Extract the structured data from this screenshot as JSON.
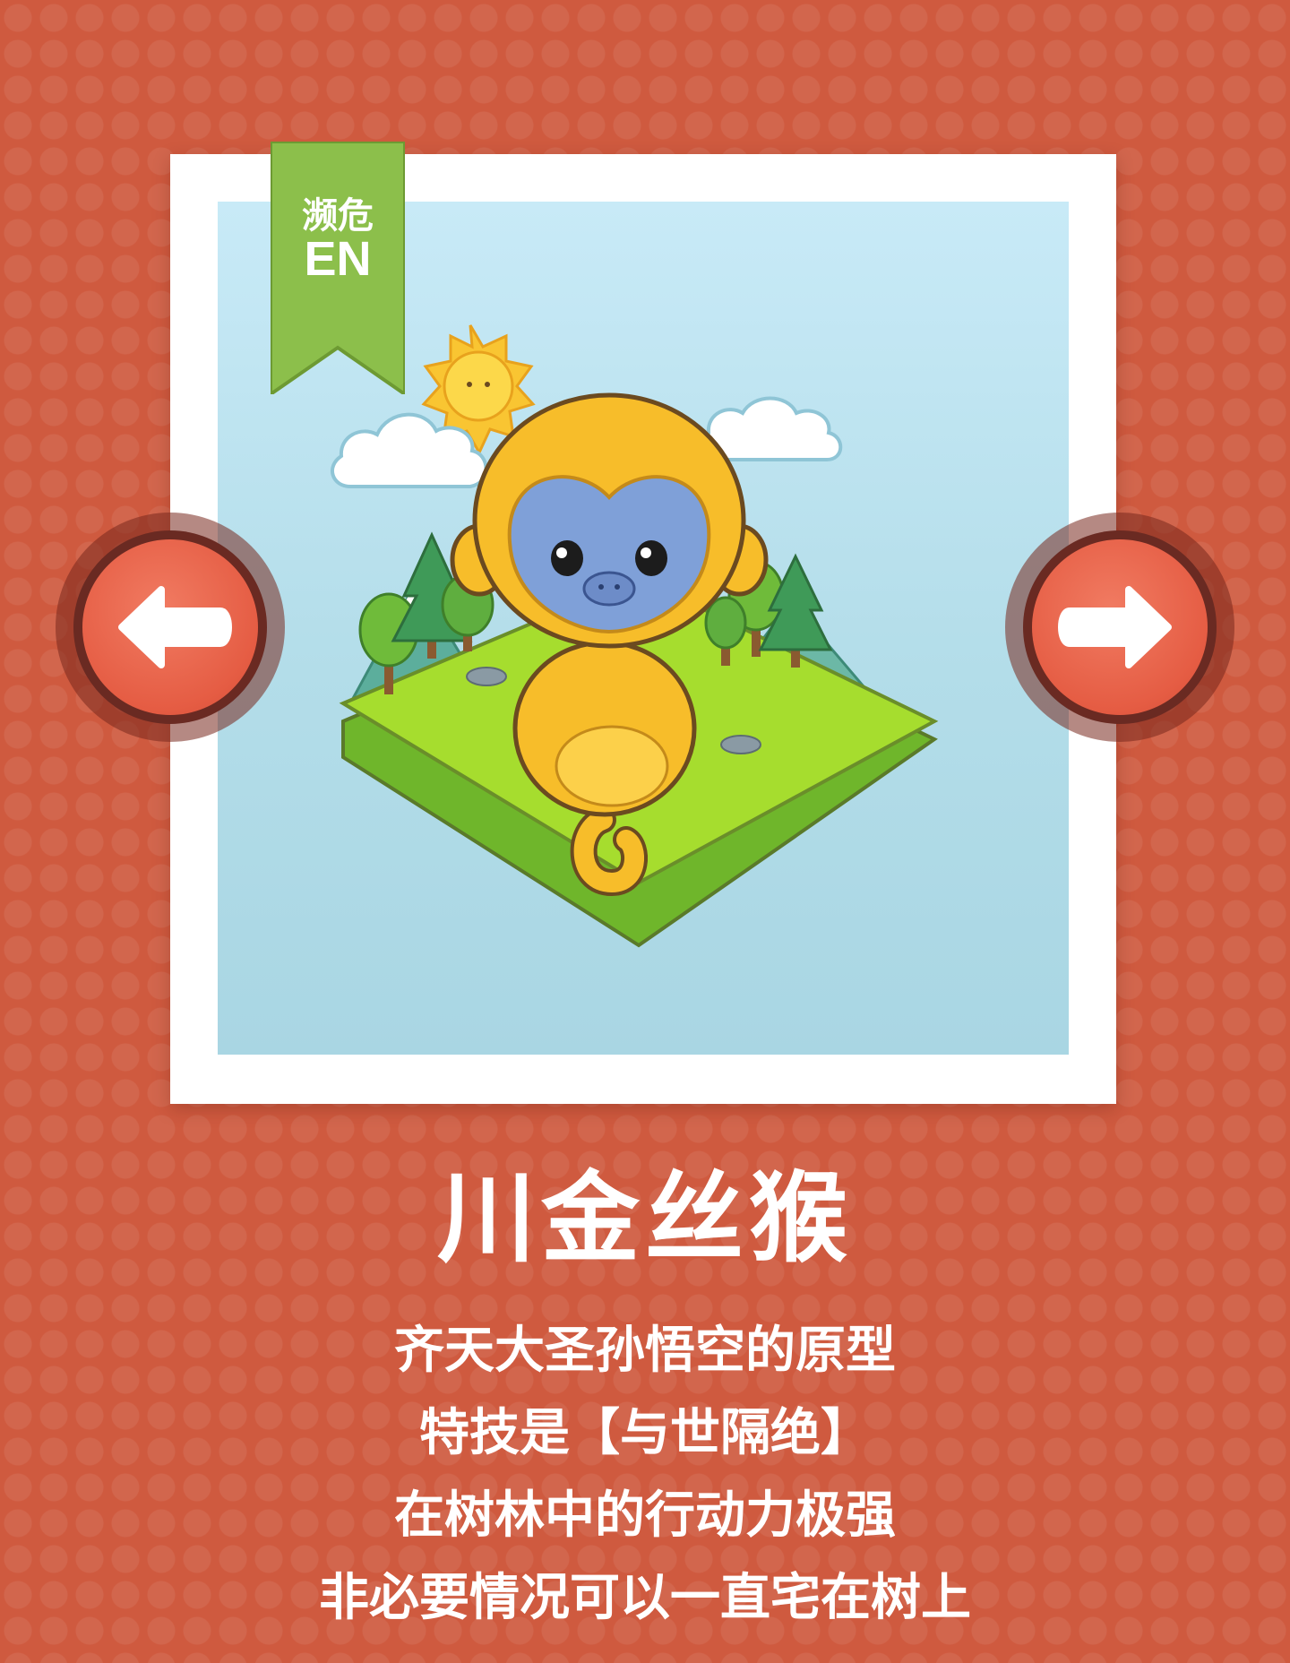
{
  "card": {
    "status_label_cn": "濒危",
    "status_code": "EN",
    "status_color": "#8cbf4b"
  },
  "animal": {
    "name": "川金丝猴",
    "description_lines": [
      "齐天大圣孙悟空的原型",
      "特技是【与世隔绝】",
      "在树林中的行动力极强",
      "非必要情况可以一直宅在树上"
    ]
  },
  "navigation": {
    "prev_icon": "arrow-left-icon",
    "next_icon": "arrow-right-icon"
  },
  "colors": {
    "background": "#cf5a3f",
    "button": "#e55c43",
    "text": "#ffffff",
    "monkey_fur": "#f5b820",
    "monkey_face": "#7fa0d8"
  }
}
